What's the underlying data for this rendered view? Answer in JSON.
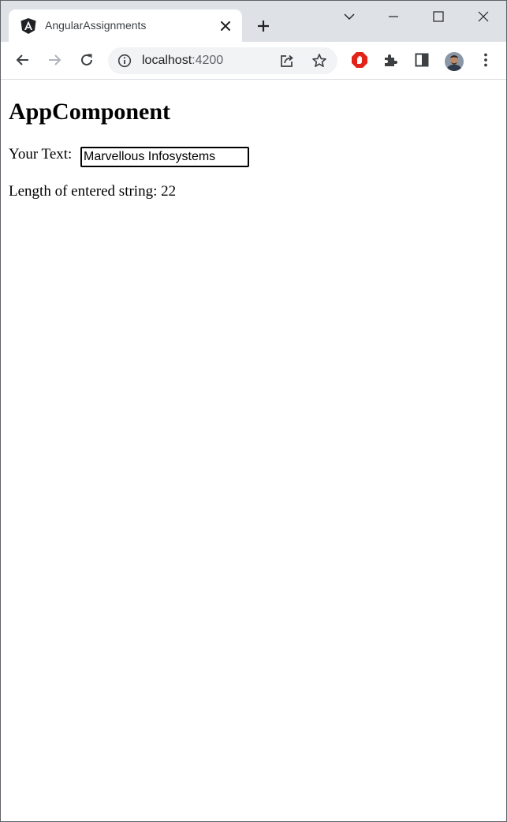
{
  "browser": {
    "tab": {
      "title": "AngularAssignments",
      "favicon": "angular-logo-icon"
    },
    "new_tab_icon": "plus-icon",
    "window_controls": [
      "tab-search-icon",
      "minimize-icon",
      "maximize-icon",
      "close-icon"
    ],
    "address_bar": {
      "host": "localhost",
      "port": ":4200"
    },
    "toolbar_icons": [
      "back-arrow-icon",
      "forward-arrow-icon",
      "reload-icon",
      "site-info-icon",
      "share-icon",
      "star-icon",
      "adblock-icon",
      "extensions-icon",
      "side-panel-icon",
      "avatar",
      "menu-dots-icon"
    ],
    "colors": {
      "tabstrip": "#dee1e6",
      "adblock": "#e2231a",
      "omnibox": "#f1f3f4"
    }
  },
  "page": {
    "title": "AppComponent",
    "input_label": "Your Text:",
    "input_value": "Marvellous Infosystems",
    "length_label": "Length of entered string:",
    "length_value": "22"
  }
}
